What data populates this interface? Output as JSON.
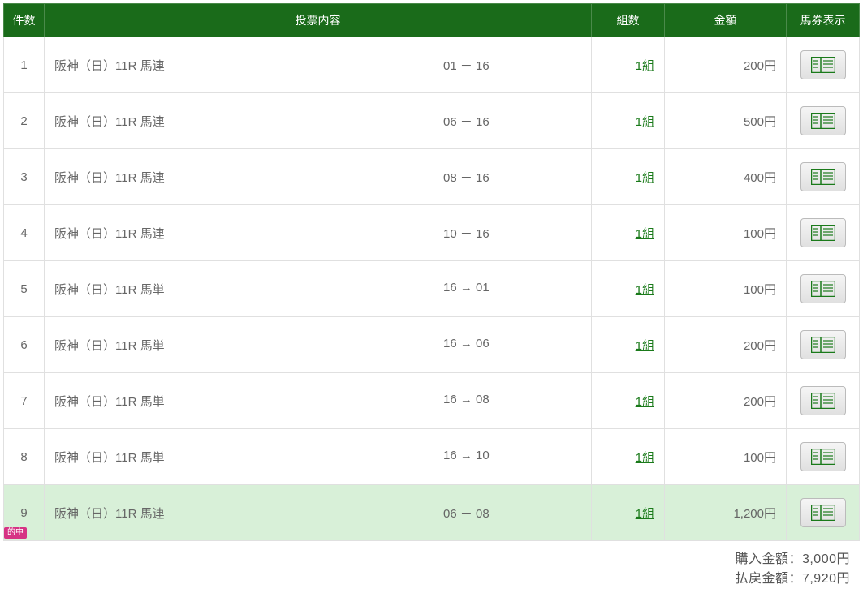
{
  "headers": {
    "num": "件数",
    "content": "投票内容",
    "pairs": "組数",
    "amount": "金額",
    "ticket": "馬券表示"
  },
  "rows": [
    {
      "num": "1",
      "label": "阪神（日）11R 馬連",
      "combo": "01 － 16",
      "pairs": "1組",
      "amount": "200円",
      "hit": false
    },
    {
      "num": "2",
      "label": "阪神（日）11R 馬連",
      "combo": "06 － 16",
      "pairs": "1組",
      "amount": "500円",
      "hit": false
    },
    {
      "num": "3",
      "label": "阪神（日）11R 馬連",
      "combo": "08 － 16",
      "pairs": "1組",
      "amount": "400円",
      "hit": false
    },
    {
      "num": "4",
      "label": "阪神（日）11R 馬連",
      "combo": "10 － 16",
      "pairs": "1組",
      "amount": "100円",
      "hit": false
    },
    {
      "num": "5",
      "label": "阪神（日）11R 馬単",
      "combo": "16 → 01",
      "pairs": "1組",
      "amount": "100円",
      "hit": false
    },
    {
      "num": "6",
      "label": "阪神（日）11R 馬単",
      "combo": "16 → 06",
      "pairs": "1組",
      "amount": "200円",
      "hit": false
    },
    {
      "num": "7",
      "label": "阪神（日）11R 馬単",
      "combo": "16 → 08",
      "pairs": "1組",
      "amount": "200円",
      "hit": false
    },
    {
      "num": "8",
      "label": "阪神（日）11R 馬単",
      "combo": "16 → 10",
      "pairs": "1組",
      "amount": "100円",
      "hit": false
    },
    {
      "num": "9",
      "label": "阪神（日）11R 馬連",
      "combo": "06 － 08",
      "pairs": "1組",
      "amount": "1,200円",
      "hit": true
    }
  ],
  "hit_badge": "的中",
  "summary": {
    "purchase_label": "購入金額：",
    "purchase_value": "3,000円",
    "payout_label": "払戻金額：",
    "payout_value": "7,920円"
  }
}
